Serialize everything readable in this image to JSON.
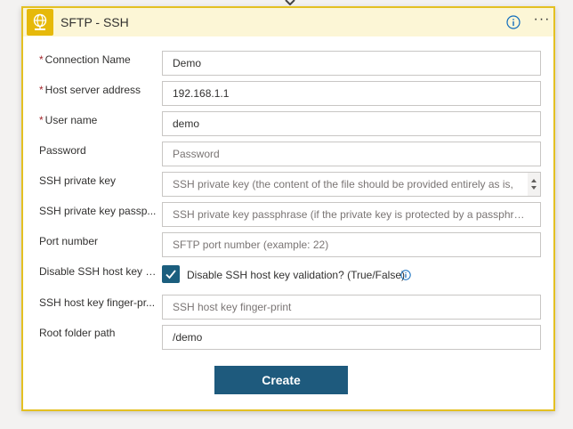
{
  "header": {
    "title": "SFTP - SSH",
    "more_label": "···"
  },
  "fields": {
    "connection_name": {
      "label": "Connection Name",
      "required_mark": "*",
      "value": "Demo"
    },
    "host_server": {
      "label": "Host server address",
      "required_mark": "*",
      "value": "192.168.1.1"
    },
    "user_name": {
      "label": "User name",
      "required_mark": "*",
      "value": "demo"
    },
    "password": {
      "label": "Password",
      "placeholder": "Password"
    },
    "ssh_private_key": {
      "label": "SSH private key",
      "placeholder": "SSH private key (the content of the file should be provided entirely as is,"
    },
    "ssh_key_passphrase": {
      "label": "SSH private key passp...",
      "placeholder": "SSH private key passphrase (if the private key is protected by a passphrase)"
    },
    "port_number": {
      "label": "Port number",
      "placeholder": "SFTP port number (example: 22)"
    },
    "disable_host_key": {
      "label": "Disable SSH host key v...",
      "checkbox_label": "Disable SSH host key validation? (True/False)",
      "checked": true
    },
    "host_key_fingerprint": {
      "label": "SSH host key finger-pr...",
      "placeholder": "SSH host key finger-print"
    },
    "root_folder": {
      "label": "Root folder path",
      "value": "/demo"
    }
  },
  "actions": {
    "create_label": "Create"
  },
  "colors": {
    "accent": "#1e5a7d",
    "header_bg": "#fcf6d6",
    "border": "#e4c022",
    "required": "#a4262c",
    "icon_bg": "#e6b90a"
  },
  "icons": {
    "app": "globe-network-icon",
    "info": "info-icon",
    "more": "more-options-icon",
    "check": "checkmark-icon"
  }
}
